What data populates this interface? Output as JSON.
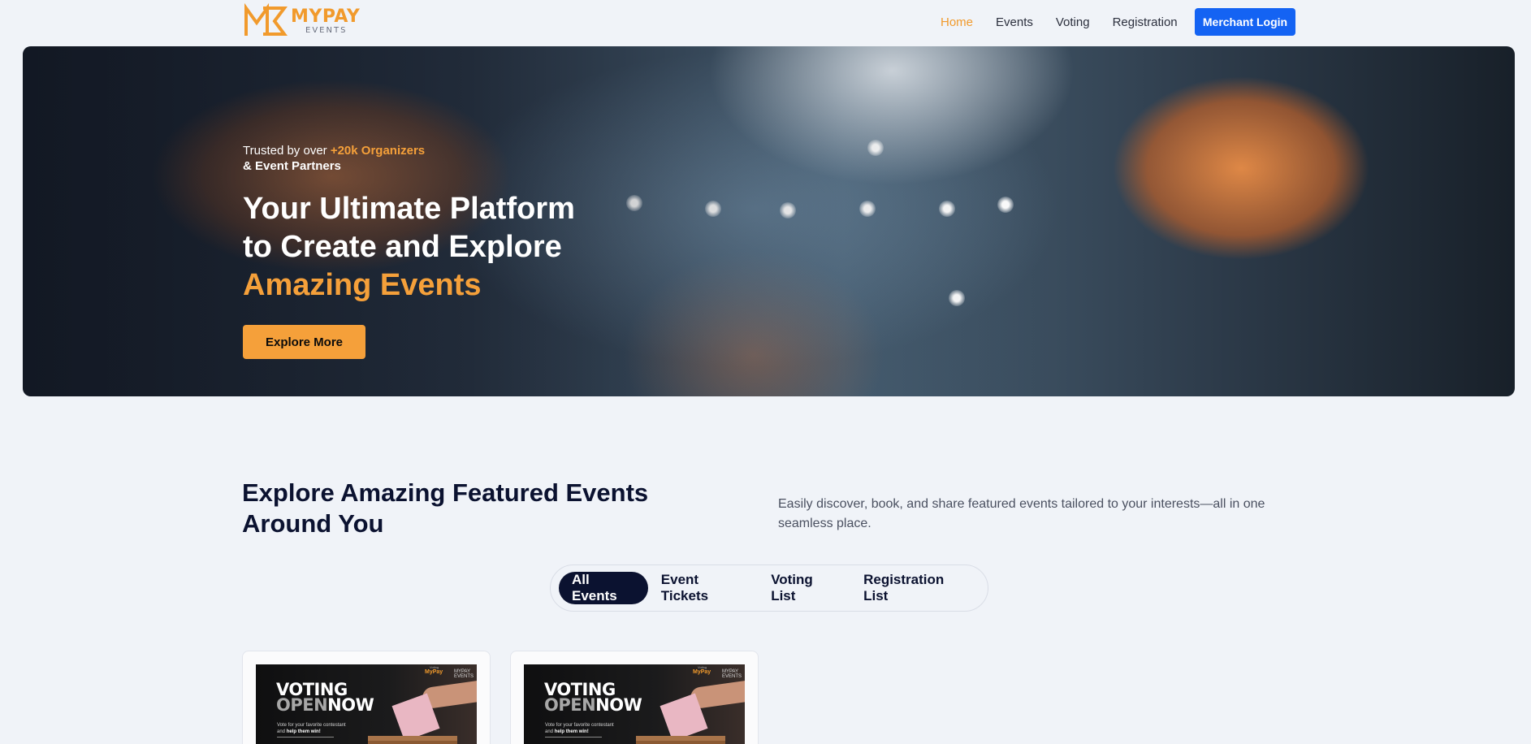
{
  "brand": {
    "name": "MYPAY",
    "sub": "EVENTS",
    "color": "#f19a2c"
  },
  "nav": {
    "links": [
      {
        "label": "Home",
        "active": true
      },
      {
        "label": "Events",
        "active": false
      },
      {
        "label": "Voting",
        "active": false
      },
      {
        "label": "Registration",
        "active": false
      }
    ],
    "merchant_login": "Merchant Login"
  },
  "hero": {
    "trusted_prefix": "Trusted by over ",
    "trusted_highlight": "+20k Organizers",
    "trusted_suffix": "& Event Partners",
    "title_line1": "Your Ultimate Platform",
    "title_line2": "to Create and Explore",
    "title_accent": "Amazing Events",
    "cta": "Explore More"
  },
  "featured": {
    "title": "Explore Amazing Featured Events Around You",
    "description": "Easily discover, book, and share featured events tailored to your interests—all in one seamless place."
  },
  "tabs": [
    {
      "label": "All Events",
      "active": true
    },
    {
      "label": "Event Tickets",
      "active": false
    },
    {
      "label": "Voting List",
      "active": false
    },
    {
      "label": "Registration List",
      "active": false
    }
  ],
  "cards": [
    {
      "line1": "VOTING",
      "line2_dim": "OPEN",
      "line2": "NOW",
      "caption_a": "Vote for your favorite contestant",
      "caption_b": "and ",
      "caption_bold": "help them win!",
      "mini_brand": "MyPay",
      "mini_sub": "MYPAY EVENTS",
      "tiny": "Voting"
    },
    {
      "line1": "VOTING",
      "line2_dim": "OPEN",
      "line2": "NOW",
      "caption_a": "Vote for your favorite contestant",
      "caption_b": "and ",
      "caption_bold": "help them win!",
      "mini_brand": "MyPay",
      "mini_sub": "MYPAY EVENTS",
      "tiny": "Voting"
    }
  ],
  "colors": {
    "accent": "#f5a03a",
    "primary": "#1463f3",
    "dark": "#0b1230"
  }
}
